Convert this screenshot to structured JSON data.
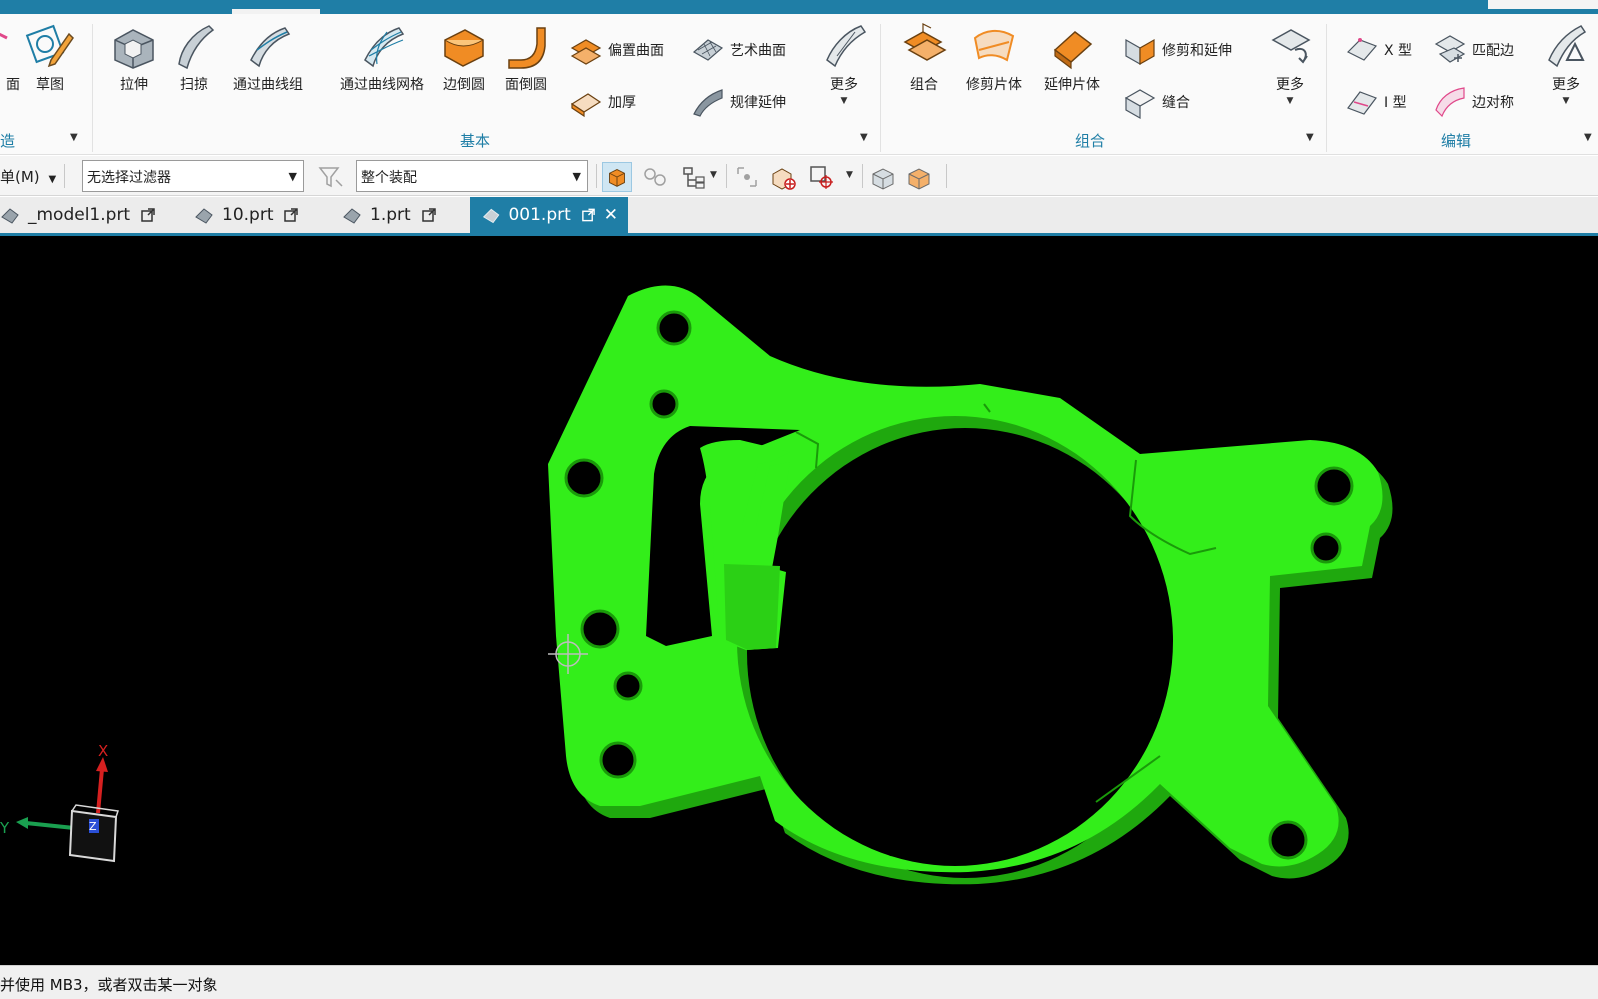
{
  "ribbon": {
    "buttons": {
      "face": "面",
      "sketch": "草图",
      "extrude": "拉伸",
      "sweep": "扫掠",
      "through_curves": "通过曲线组",
      "through_curve_mesh": "通过曲线网格",
      "edge_blend": "边倒圆",
      "face_blend": "面倒圆",
      "offset_surface": "偏置曲面",
      "thicken": "加厚",
      "studio_surface": "艺术曲面",
      "law_extension": "规律延伸",
      "more_basic": "更多",
      "unite": "组合",
      "trim_sheet": "修剪片体",
      "extend_sheet": "延伸片体",
      "trim_and_extend": "修剪和延伸",
      "sew": "缝合",
      "more_combine": "更多",
      "x_form": "X 型",
      "i_form": "I 型",
      "match_edge": "匹配边",
      "edge_symmetry": "边对称",
      "more_edit": "更多"
    },
    "groups": {
      "construct": "造",
      "basic": "基本",
      "combine": "组合",
      "edit": "编辑"
    }
  },
  "selection_bar": {
    "menu_label": "单(M)",
    "filter_value": "无选择过滤器",
    "scope_value": "整个装配"
  },
  "tabs": [
    {
      "label": "_model1.prt"
    },
    {
      "label": "10.prt"
    },
    {
      "label": "1.prt"
    },
    {
      "label": "001.prt",
      "active": true
    }
  ],
  "viewport": {
    "background": "#000000",
    "part_color": "#33ee1a",
    "triad": {
      "x": "X",
      "y": "Y",
      "z": "Z"
    }
  },
  "status": {
    "message": "并使用 MB3，或者双击某一对象"
  },
  "colors": {
    "accent": "#1f7ea6",
    "icon_orange": "#f08c24",
    "icon_gray": "#8a96a0"
  }
}
